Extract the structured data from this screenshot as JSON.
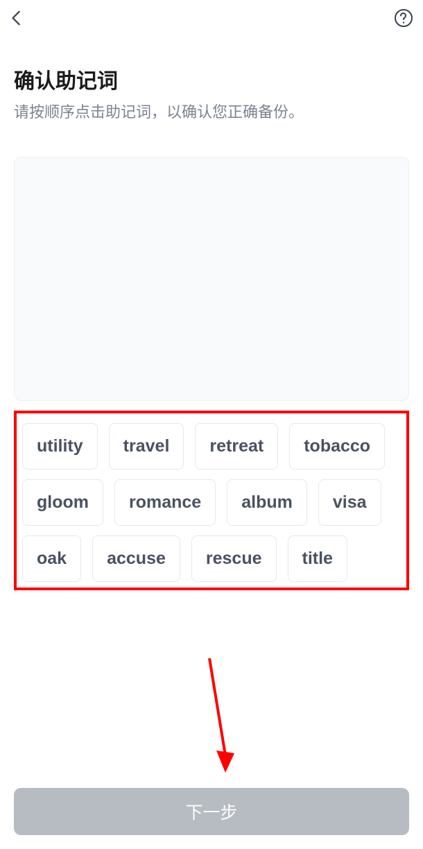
{
  "header": {
    "back_icon": "back",
    "help_icon": "help"
  },
  "title": "确认助记词",
  "subtitle": "请按顺序点击助记词，以确认您正确备份。",
  "words": [
    "utility",
    "travel",
    "retreat",
    "tobacco",
    "gloom",
    "romance",
    "album",
    "visa",
    "oak",
    "accuse",
    "rescue",
    "title"
  ],
  "next_button": "下一步",
  "annotations": {
    "highlight_color": "#ff0000",
    "arrow_color": "#ff0000"
  }
}
